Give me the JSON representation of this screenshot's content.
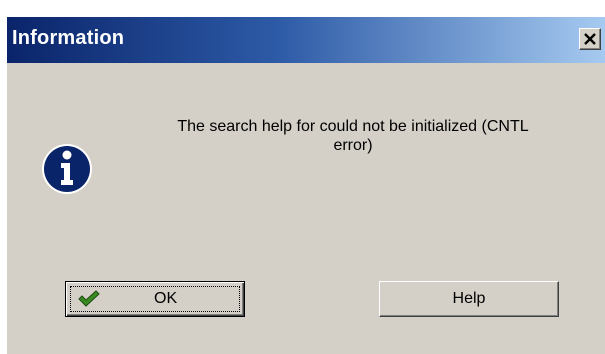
{
  "dialog": {
    "title": "Information",
    "close_icon": "close-x-icon",
    "info_icon": "information-icon",
    "message_line1": "The search help for  could not be initialized (CNTL",
    "message_line2": "error)",
    "buttons": {
      "ok_label": "OK",
      "ok_icon": "checkmark-icon",
      "help_label": "Help"
    }
  },
  "colors": {
    "title_bar_start": "#0a246a",
    "title_bar_end": "#a6caf0",
    "dialog_background": "#d4d0c8",
    "icon_blue": "#0a246a",
    "checkmark_green": "#3a8a22"
  }
}
